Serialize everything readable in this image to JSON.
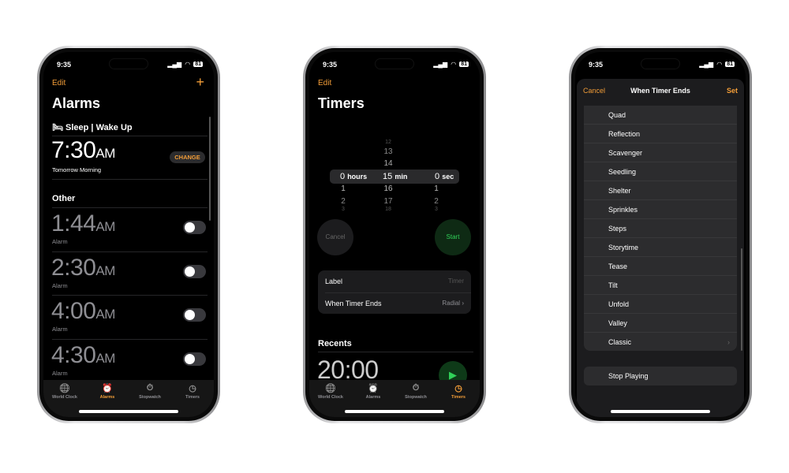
{
  "status": {
    "time": "9:35",
    "battery": "81"
  },
  "alarms": {
    "edit": "Edit",
    "add_icon": "plus-icon",
    "title": "Alarms",
    "sleep_header": "Sleep | Wake Up",
    "sleep_time": "7:30",
    "sleep_ampm": "AM",
    "sleep_sub": "Tomorrow Morning",
    "change": "CHANGE",
    "other": "Other",
    "items": [
      {
        "time": "1:44",
        "ampm": "AM",
        "label": "Alarm",
        "on": false
      },
      {
        "time": "2:30",
        "ampm": "AM",
        "label": "Alarm",
        "on": false
      },
      {
        "time": "4:00",
        "ampm": "AM",
        "label": "Alarm",
        "on": false
      },
      {
        "time": "4:30",
        "ampm": "AM",
        "label": "Alarm",
        "on": false
      }
    ]
  },
  "tabs": [
    {
      "label": "World Clock",
      "icon": "globe-icon"
    },
    {
      "label": "Alarms",
      "icon": "alarm-clock-icon"
    },
    {
      "label": "Stopwatch",
      "icon": "stopwatch-icon"
    },
    {
      "label": "Timers",
      "icon": "timer-icon"
    }
  ],
  "timers": {
    "edit": "Edit",
    "title": "Timers",
    "picker": {
      "hours": {
        "value": "0",
        "unit": "hours",
        "below": [
          "1",
          "2",
          "3"
        ]
      },
      "minutes": {
        "value": "15",
        "unit": "min",
        "above": [
          "12",
          "13",
          "14"
        ],
        "below": [
          "16",
          "17",
          "18"
        ]
      },
      "seconds": {
        "value": "0",
        "unit": "sec",
        "below": [
          "1",
          "2",
          "3"
        ]
      }
    },
    "cancel": "Cancel",
    "start": "Start",
    "label_row": "Label",
    "label_value": "Timer",
    "ends_row": "When Timer Ends",
    "ends_value": "Radial",
    "recents": "Recents",
    "recent_time": "20:00"
  },
  "sheet": {
    "cancel": "Cancel",
    "title": "When Timer Ends",
    "set": "Set",
    "sounds": [
      "Quad",
      "Reflection",
      "Scavenger",
      "Seedling",
      "Shelter",
      "Sprinkles",
      "Steps",
      "Storytime",
      "Tease",
      "Tilt",
      "Unfold",
      "Valley",
      "Classic"
    ],
    "stop": "Stop Playing"
  },
  "colors": {
    "accent": "#f29d38",
    "start_green": "#30d158"
  }
}
